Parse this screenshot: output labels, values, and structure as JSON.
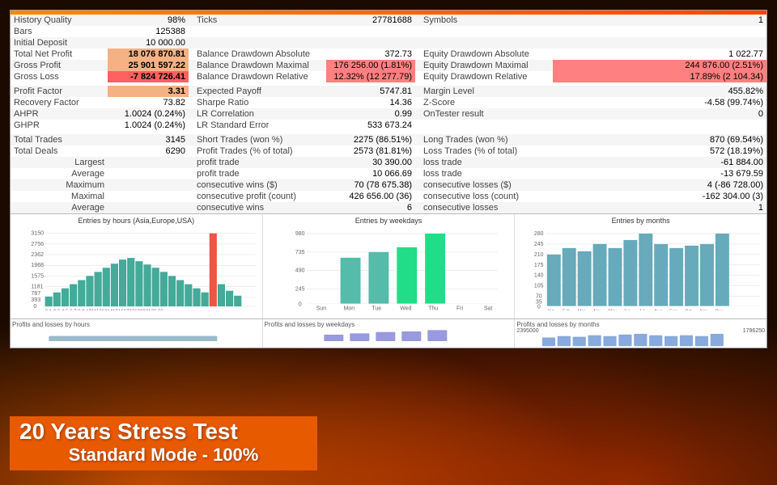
{
  "topBar": {
    "historyQuality": "History Quality",
    "historyQualityVal": "98%",
    "bars": "Bars",
    "barsVal": "125388",
    "initialDeposit": "Initial Deposit",
    "initialDepositVal": "10 000.00",
    "totalNetProfit": "Total Net Profit",
    "totalNetProfitVal": "18 076 870.81",
    "grossProfit": "Gross Profit",
    "grossProfitVal": "25 901 597.22",
    "grossLoss": "Gross Loss",
    "grossLossVal": "-7 824 726.41"
  },
  "ticks": "Ticks",
  "ticksVal": "27781688",
  "symbols": "Symbols",
  "symbolsVal": "1",
  "balanceDrawdownAbsolute": "Balance Drawdown Absolute",
  "balanceDrawdownAbsoluteVal": "372.73",
  "equityDrawdownAbsolute": "Equity Drawdown Absolute",
  "equityDrawdownAbsoluteVal": "1 022.77",
  "balanceDrawdownMaximal": "Balance Drawdown Maximal",
  "balanceDrawdownMaximalVal": "176 256.00 (1.81%)",
  "equityDrawdownMaximal": "Equity Drawdown Maximal",
  "equityDrawdownMaximalVal": "244 876.00 (2.51%)",
  "balanceDrawdownRelative": "Balance Drawdown Relative",
  "balanceDrawdownRelativeVal": "12.32% (12 277.79)",
  "equityDrawdownRelative": "Equity Drawdown Relative",
  "equityDrawdownRelativeVal": "17.89% (2 104.34)",
  "profitFactor": "Profit Factor",
  "profitFactorVal": "3.31",
  "expectedPayoff": "Expected Payoff",
  "expectedPayoffVal": "5747.81",
  "marginLevel": "Margin Level",
  "marginLevelVal": "455.82%",
  "recoveryFactor": "Recovery Factor",
  "recoveryFactorVal": "73.82",
  "sharpeRatio": "Sharpe Ratio",
  "sharpeRatioVal": "14.36",
  "zScore": "Z-Score",
  "zScoreVal": "-4.58 (99.74%)",
  "ahpr": "AHPR",
  "ahprVal": "1.0024 (0.24%)",
  "lrCorrelation": "LR Correlation",
  "lrCorrelationVal": "0.99",
  "onTesterResult": "OnTester result",
  "onTesterResultVal": "0",
  "ghpr": "GHPR",
  "ghprVal": "1.0024 (0.24%)",
  "lrStandardError": "LR Standard Error",
  "lrStandardErrorVal": "533 673.24",
  "totalTrades": "Total Trades",
  "totalTradesVal": "3145",
  "shortTrades": "Short Trades (won %)",
  "shortTradesVal": "2275 (86.51%)",
  "longTrades": "Long Trades (won %)",
  "longTradesVal": "870 (69.54%)",
  "totalDeals": "Total Deals",
  "totalDealsVal": "6290",
  "profitTrades": "Profit Trades (% of total)",
  "profitTradesVal": "2573 (81.81%)",
  "lossTrades": "Loss Trades (% of total)",
  "lossTradesVal": "572 (18.19%)",
  "largest": "Largest",
  "largestProfitTrade": "profit trade",
  "largestProfitTradeVal": "30 390.00",
  "largestLossTrade": "loss trade",
  "largestLossTradeVal": "-61 884.00",
  "average": "Average",
  "avgProfitTrade": "profit trade",
  "avgProfitTradeVal": "10 066.69",
  "avgLossTrade": "loss trade",
  "avgLossTradeVal": "-13 679.59",
  "maximum": "Maximum",
  "maxConsecWins": "consecutive wins ($)",
  "maxConsecWinsVal": "70 (78 675.38)",
  "maxConsecLosses": "consecutive losses ($)",
  "maxConsecLossesVal": "4 (-86 728.00)",
  "maximal": "Maximal",
  "maxConsecProfit": "consecutive profit (count)",
  "maxConsecProfitVal": "426 656.00 (36)",
  "maxConsecLoss": "consecutive loss (count)",
  "maxConsecLossVal": "-162 304.00 (3)",
  "averageLabel": "Average",
  "avgConsecWins": "consecutive wins",
  "avgConsecWinsVal": "6",
  "avgConsecLosses": "consecutive losses",
  "avgConsecLossesVal": "1",
  "charts": {
    "hoursTitle": "Entries by hours (Asia,Europe,USA)",
    "weekdaysTitle": "Entries by weekdays",
    "monthsTitle": "Entries by months",
    "hoursYLabels": [
      "3150",
      "2756",
      "2362",
      "1968",
      "1575",
      "1181",
      "787",
      "393",
      "0"
    ],
    "weekdaysYLabels": [
      "980",
      "735",
      "490",
      "245",
      "0"
    ],
    "weekdaysBars": [
      {
        "label": "Sun",
        "val": 0
      },
      {
        "label": "Mon",
        "val": 60
      },
      {
        "label": "Tue",
        "val": 75
      },
      {
        "label": "Wed",
        "val": 80
      },
      {
        "label": "Thu",
        "val": 100
      },
      {
        "label": "Fri",
        "val": 0
      },
      {
        "label": "Sat",
        "val": 0
      }
    ],
    "monthsYLabels": [
      "280",
      "245",
      "210",
      "175",
      "140",
      "105",
      "70",
      "35",
      "0"
    ],
    "monthsBars": [
      {
        "label": "Jan",
        "val": 75
      },
      {
        "label": "Feb",
        "val": 85
      },
      {
        "label": "Mar",
        "val": 80
      },
      {
        "label": "Apr",
        "val": 90
      },
      {
        "label": "May",
        "val": 85
      },
      {
        "label": "Jun",
        "val": 95
      },
      {
        "label": "Jul",
        "val": 100
      },
      {
        "label": "Aug",
        "val": 90
      },
      {
        "label": "Sep",
        "val": 85
      },
      {
        "label": "Oct",
        "val": 88
      },
      {
        "label": "Nov",
        "val": 90
      },
      {
        "label": "Dec",
        "val": 100
      }
    ]
  },
  "stressTest": {
    "line1": "20 Years Stress Test",
    "line2": "Standard Mode - 100%"
  },
  "profitLossCharts": {
    "weekdaysTitle": "Profits and losses by weekdays",
    "monthsTitle": "Profits and losses by months",
    "monthsYLabels": [
      "2395000",
      "1796250"
    ]
  }
}
